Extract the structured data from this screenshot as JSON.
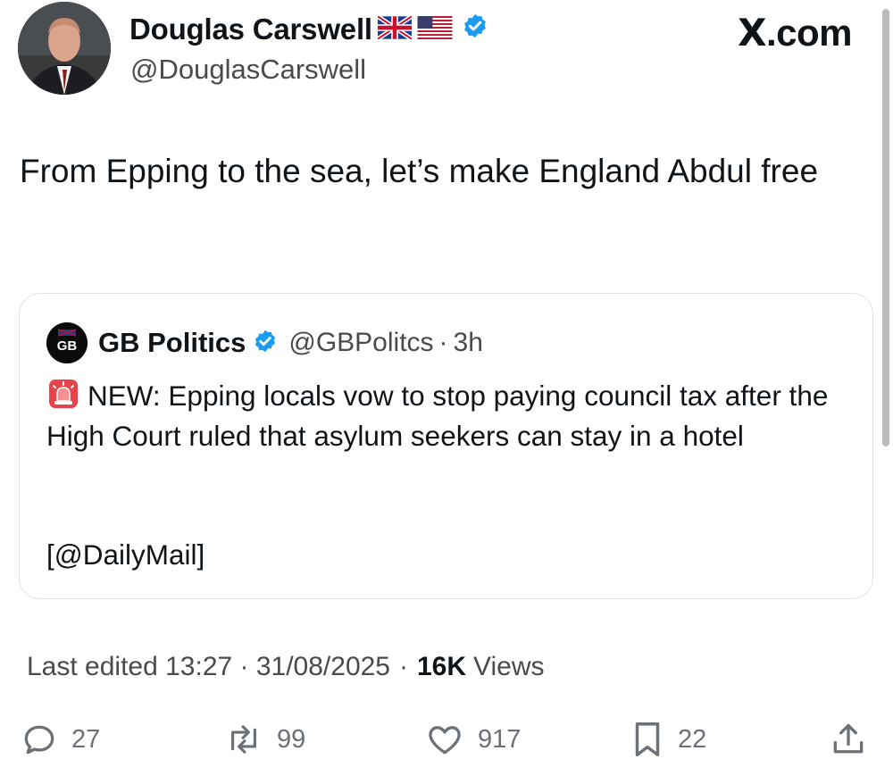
{
  "author": {
    "display_name": "Douglas Carswell",
    "handle": "@DouglasCarswell",
    "flags": [
      "uk-flag-icon",
      "us-flag-icon"
    ],
    "verified": true
  },
  "brand": {
    "site": ".com",
    "logo": "X"
  },
  "tweet": {
    "text": "From Epping to the sea, let’s make England Abdul free"
  },
  "quoted": {
    "display_name": "GB Politics",
    "handle": "@GBPolitcs",
    "separator": "·",
    "time": "3h",
    "avatar_text": "GB",
    "body": "NEW: Epping locals vow to stop paying council tax after the High Court ruled that asylum seekers can stay in a hotel",
    "source": "[@DailyMail]"
  },
  "meta": {
    "edited": "Last edited 13:27 · 31/08/2025",
    "sep": "·",
    "views_count": "16K",
    "views_label": "Views"
  },
  "actions": {
    "replies": "27",
    "reposts": "99",
    "likes": "917",
    "bookmarks": "22"
  },
  "colors": {
    "verified": "#1d9bf0",
    "text": "#0f1419",
    "secondary": "#4a4a4a",
    "icon": "#6b7177",
    "border": "#dfe3e6"
  }
}
